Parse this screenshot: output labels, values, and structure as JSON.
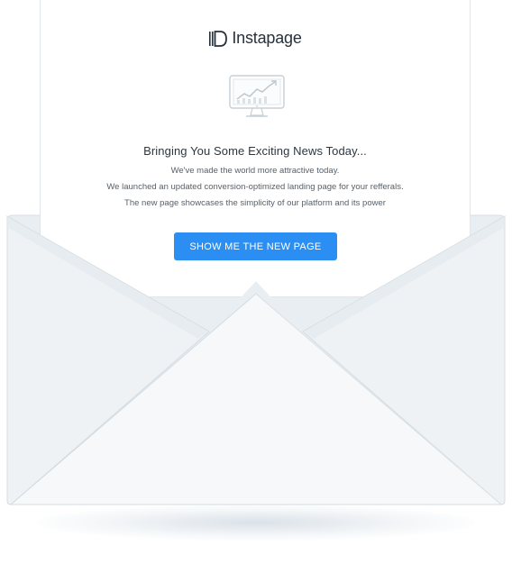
{
  "brand": {
    "name": "Instapage"
  },
  "email": {
    "headline": "Bringing You Some Exciting News Today...",
    "lines": [
      "We've made the world more attractive today.",
      "We launched an updated conversion-optimized landing page for your refferals.",
      "The new page showcases the simplicity of our platform and its power"
    ],
    "cta_label": "SHOW ME THE NEW PAGE"
  },
  "icons": {
    "brand": "instapage-logo-icon",
    "illustration": "monitor-chart-icon"
  },
  "colors": {
    "accent": "#2b8ef2",
    "envelope": "#f4f7f9",
    "envelope_shade": "#e6ecf0",
    "text_dark": "#2c3740",
    "text_body": "#56616b"
  }
}
